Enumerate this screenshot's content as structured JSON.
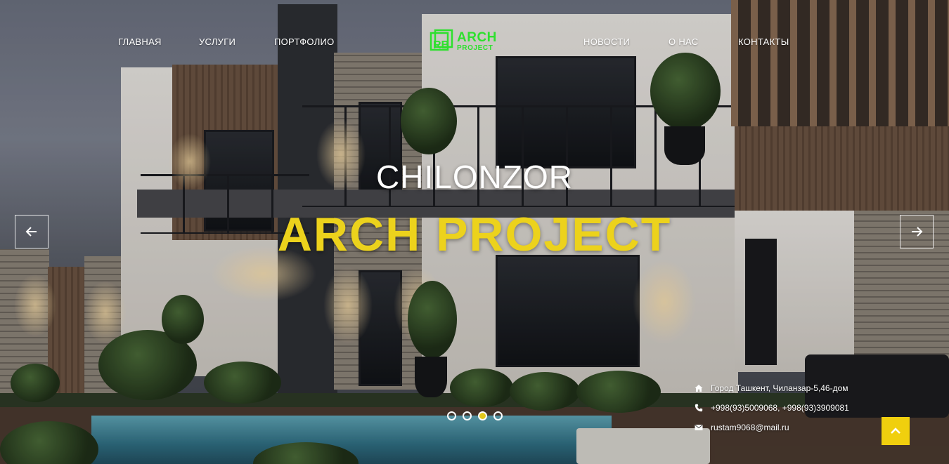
{
  "nav": {
    "left": [
      "ГЛАВНАЯ",
      "УСЛУГИ",
      "ПОРТФОЛИО"
    ],
    "right": [
      "НОВОСТИ",
      "О НАС",
      "КОНТАКТЫ"
    ]
  },
  "logo": {
    "line1": "ARCH",
    "line2": "PROJECT",
    "mark_letters": "RB",
    "color": "#2ee02e"
  },
  "hero": {
    "subtitle": "CHILONZOR",
    "title": "ARCH PROJECT",
    "title_color": "#ecd21c"
  },
  "slider": {
    "prev_icon": "arrow-left-icon",
    "next_icon": "arrow-right-icon",
    "slide_count": 4,
    "active_index": 2,
    "active_color": "#e2c81c"
  },
  "contacts": {
    "address": "Город Ташкент, Чиланзар-5,46-дом",
    "phones": "+998(93)5009068, +998(93)3909081",
    "email": "rustam9068@mail.ru",
    "icons": [
      "home-icon",
      "phone-icon",
      "envelope-icon"
    ]
  },
  "back_to_top": {
    "icon": "chevron-up-icon",
    "color": "#f0cf0e"
  }
}
